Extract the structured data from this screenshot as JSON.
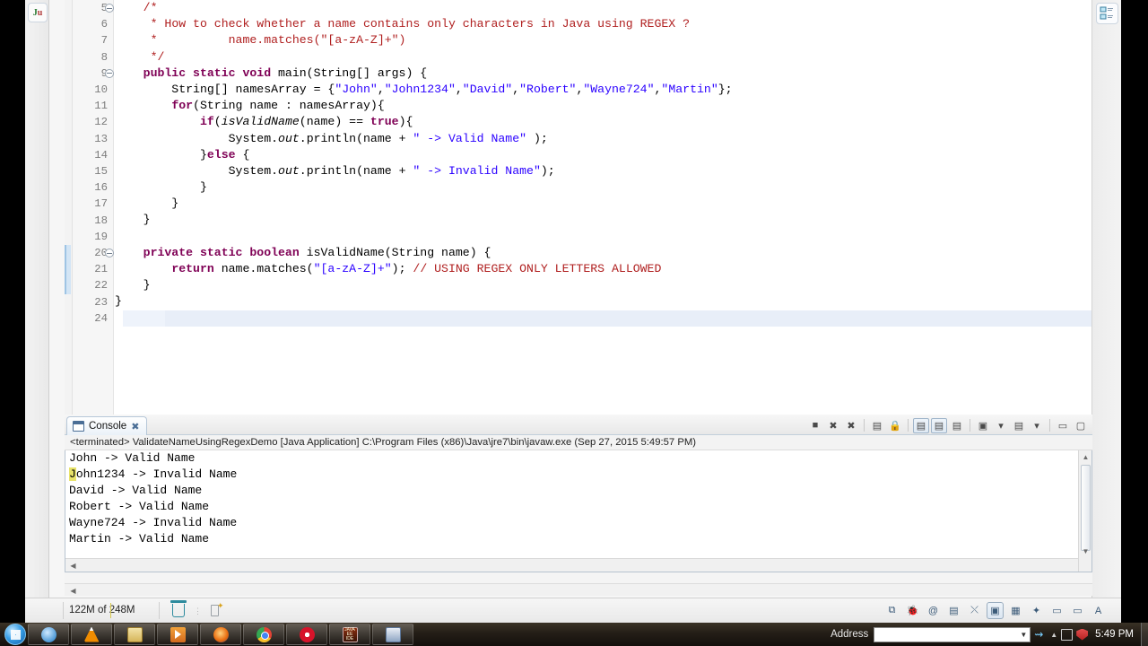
{
  "ide": {
    "fast_view_left": {
      "label": "Ju",
      "name": "junit-view"
    },
    "fast_view_right": {
      "name": "outline-view"
    },
    "editor": {
      "current_line": 24,
      "lines": [
        {
          "num": "5",
          "fold": true,
          "change": false,
          "tokens": [
            {
              "t": "    ",
              "c": "pl"
            },
            {
              "t": "/*",
              "c": "jd"
            }
          ]
        },
        {
          "num": "6",
          "fold": false,
          "change": false,
          "tokens": [
            {
              "t": "     ",
              "c": "pl"
            },
            {
              "t": "* How to check whether a name contains only characters in Java using REGEX ?",
              "c": "jd"
            }
          ]
        },
        {
          "num": "7",
          "fold": false,
          "change": false,
          "tokens": [
            {
              "t": "     ",
              "c": "pl"
            },
            {
              "t": "*          name.matches(\"[a-zA-Z]+\")",
              "c": "jd"
            }
          ]
        },
        {
          "num": "8",
          "fold": false,
          "change": false,
          "tokens": [
            {
              "t": "     ",
              "c": "pl"
            },
            {
              "t": "*/",
              "c": "jd"
            }
          ]
        },
        {
          "num": "9",
          "fold": true,
          "change": false,
          "tokens": [
            {
              "t": "    ",
              "c": "pl"
            },
            {
              "t": "public static void",
              "c": "k"
            },
            {
              "t": " main(String[] args) {",
              "c": "pl"
            }
          ]
        },
        {
          "num": "10",
          "fold": false,
          "change": false,
          "tokens": [
            {
              "t": "        String[] namesArray = {",
              "c": "pl"
            },
            {
              "t": "\"John\"",
              "c": "str"
            },
            {
              "t": ",",
              "c": "pl"
            },
            {
              "t": "\"John1234\"",
              "c": "str"
            },
            {
              "t": ",",
              "c": "pl"
            },
            {
              "t": "\"David\"",
              "c": "str"
            },
            {
              "t": ",",
              "c": "pl"
            },
            {
              "t": "\"Robert\"",
              "c": "str"
            },
            {
              "t": ",",
              "c": "pl"
            },
            {
              "t": "\"Wayne724\"",
              "c": "str"
            },
            {
              "t": ",",
              "c": "pl"
            },
            {
              "t": "\"Martin\"",
              "c": "str"
            },
            {
              "t": "};",
              "c": "pl"
            }
          ]
        },
        {
          "num": "11",
          "fold": false,
          "change": false,
          "tokens": [
            {
              "t": "        ",
              "c": "pl"
            },
            {
              "t": "for",
              "c": "k"
            },
            {
              "t": "(String name : namesArray){",
              "c": "pl"
            }
          ]
        },
        {
          "num": "12",
          "fold": false,
          "change": false,
          "tokens": [
            {
              "t": "            ",
              "c": "pl"
            },
            {
              "t": "if",
              "c": "k"
            },
            {
              "t": "(",
              "c": "pl"
            },
            {
              "t": "isValidName",
              "c": "ita"
            },
            {
              "t": "(name) == ",
              "c": "pl"
            },
            {
              "t": "true",
              "c": "k"
            },
            {
              "t": "){",
              "c": "pl"
            }
          ]
        },
        {
          "num": "13",
          "fold": false,
          "change": false,
          "tokens": [
            {
              "t": "                System.",
              "c": "pl"
            },
            {
              "t": "out",
              "c": "ita"
            },
            {
              "t": ".println(name + ",
              "c": "pl"
            },
            {
              "t": "\" -> Valid Name\"",
              "c": "str"
            },
            {
              "t": " );",
              "c": "pl"
            }
          ]
        },
        {
          "num": "14",
          "fold": false,
          "change": false,
          "tokens": [
            {
              "t": "            }",
              "c": "pl"
            },
            {
              "t": "else",
              "c": "k"
            },
            {
              "t": " {",
              "c": "pl"
            }
          ]
        },
        {
          "num": "15",
          "fold": false,
          "change": false,
          "tokens": [
            {
              "t": "                System.",
              "c": "pl"
            },
            {
              "t": "out",
              "c": "ita"
            },
            {
              "t": ".println(name + ",
              "c": "pl"
            },
            {
              "t": "\" -> Invalid Name\"",
              "c": "str"
            },
            {
              "t": ");",
              "c": "pl"
            }
          ]
        },
        {
          "num": "16",
          "fold": false,
          "change": false,
          "tokens": [
            {
              "t": "            }",
              "c": "pl"
            }
          ]
        },
        {
          "num": "17",
          "fold": false,
          "change": false,
          "tokens": [
            {
              "t": "        }",
              "c": "pl"
            }
          ]
        },
        {
          "num": "18",
          "fold": false,
          "change": false,
          "tokens": [
            {
              "t": "    }",
              "c": "pl"
            }
          ]
        },
        {
          "num": "19",
          "fold": false,
          "change": false,
          "tokens": [
            {
              "t": "",
              "c": "pl"
            }
          ]
        },
        {
          "num": "20",
          "fold": true,
          "change": true,
          "tokens": [
            {
              "t": "    ",
              "c": "pl"
            },
            {
              "t": "private static boolean",
              "c": "k"
            },
            {
              "t": " isValidName(String name) {",
              "c": "pl"
            }
          ]
        },
        {
          "num": "21",
          "fold": false,
          "change": true,
          "tokens": [
            {
              "t": "        ",
              "c": "pl"
            },
            {
              "t": "return",
              "c": "k"
            },
            {
              "t": " name.matches(",
              "c": "pl"
            },
            {
              "t": "\"[a-zA-Z]+\"",
              "c": "str"
            },
            {
              "t": "); ",
              "c": "pl"
            },
            {
              "t": "// USING REGEX ONLY LETTERS ALLOWED",
              "c": "jd"
            }
          ]
        },
        {
          "num": "22",
          "fold": false,
          "change": true,
          "tokens": [
            {
              "t": "    }",
              "c": "pl"
            }
          ]
        },
        {
          "num": "23",
          "fold": false,
          "change": false,
          "tokens": [
            {
              "t": "}",
              "c": "pl"
            }
          ]
        },
        {
          "num": "24",
          "fold": false,
          "change": false,
          "tokens": [
            {
              "t": "",
              "c": "pl"
            }
          ]
        }
      ]
    },
    "console": {
      "tab_label": "Console",
      "stack_line": "<terminated> ValidateNameUsingRegexDemo [Java Application] C:\\Program Files (x86)\\Java\\jre7\\bin\\javaw.exe (Sep 27, 2015 5:49:57 PM)",
      "output": [
        "John -> Valid Name",
        "John1234 -> Invalid Name",
        "David -> Valid Name",
        "Robert -> Valid Name",
        "Wayne724 -> Invalid Name",
        "Martin -> Valid Name"
      ],
      "toolbar": [
        {
          "name": "terminate-button",
          "glyph": "■"
        },
        {
          "name": "remove-launch-button",
          "glyph": "✖"
        },
        {
          "name": "remove-all-terminated-button",
          "glyph": "✖"
        },
        {
          "name": "clear-console-button",
          "glyph": "▤"
        },
        {
          "name": "scroll-lock-button",
          "glyph": "🔒"
        },
        {
          "name": "show-console-on-output-button",
          "glyph": "▤",
          "boxed": true
        },
        {
          "name": "show-console-on-error-button",
          "glyph": "▤",
          "boxed": true
        },
        {
          "name": "pin-console-button",
          "glyph": "▤"
        },
        {
          "name": "display-selected-console-button",
          "glyph": "▣"
        },
        {
          "name": "display-selected-dropdown",
          "glyph": "▾"
        },
        {
          "name": "open-console-button",
          "glyph": "▤"
        },
        {
          "name": "open-console-dropdown",
          "glyph": "▾"
        },
        {
          "name": "minimize-view-button",
          "glyph": "▭"
        },
        {
          "name": "maximize-view-button",
          "glyph": "▢"
        }
      ]
    },
    "statusbar": {
      "heap": "122M of 248M",
      "perspective_icons": [
        {
          "name": "perspective-open-icon",
          "glyph": "⧉"
        },
        {
          "name": "debug-perspective-icon",
          "glyph": "🐞"
        },
        {
          "name": "email-perspective-icon",
          "glyph": "@"
        },
        {
          "name": "resource-perspective-icon",
          "glyph": "▤"
        },
        {
          "name": "team-sync-perspective-icon",
          "glyph": "⤬"
        },
        {
          "name": "java-perspective-icon",
          "glyph": "▣",
          "selected": true
        },
        {
          "name": "java-ee-perspective-icon",
          "glyph": "▦"
        },
        {
          "name": "debug-bug-icon",
          "glyph": "✦"
        },
        {
          "name": "java-browsing-icon",
          "glyph": "▭"
        },
        {
          "name": "database-perspective-icon",
          "glyph": "▭"
        },
        {
          "name": "more-perspectives-icon",
          "glyph": "A"
        }
      ]
    }
  },
  "taskbar": {
    "start_name": "start-orb",
    "apps": [
      {
        "name": "taskbar-internet-explorer",
        "cls": "ie"
      },
      {
        "name": "taskbar-vlc-media-player",
        "cls": "vlc"
      },
      {
        "name": "taskbar-notepad",
        "cls": "note"
      },
      {
        "name": "taskbar-media-player",
        "cls": "mplay"
      },
      {
        "name": "taskbar-firefox",
        "cls": "ff"
      },
      {
        "name": "taskbar-chrome",
        "cls": "chr"
      },
      {
        "name": "taskbar-opera",
        "cls": "opr"
      },
      {
        "name": "taskbar-java-ee-ide",
        "cls": "jee",
        "label": "JAVA EE IDE"
      },
      {
        "name": "taskbar-eclipse",
        "cls": "ecl"
      }
    ],
    "address_label": "Address",
    "address_value": "",
    "clock": "5:49 PM"
  }
}
